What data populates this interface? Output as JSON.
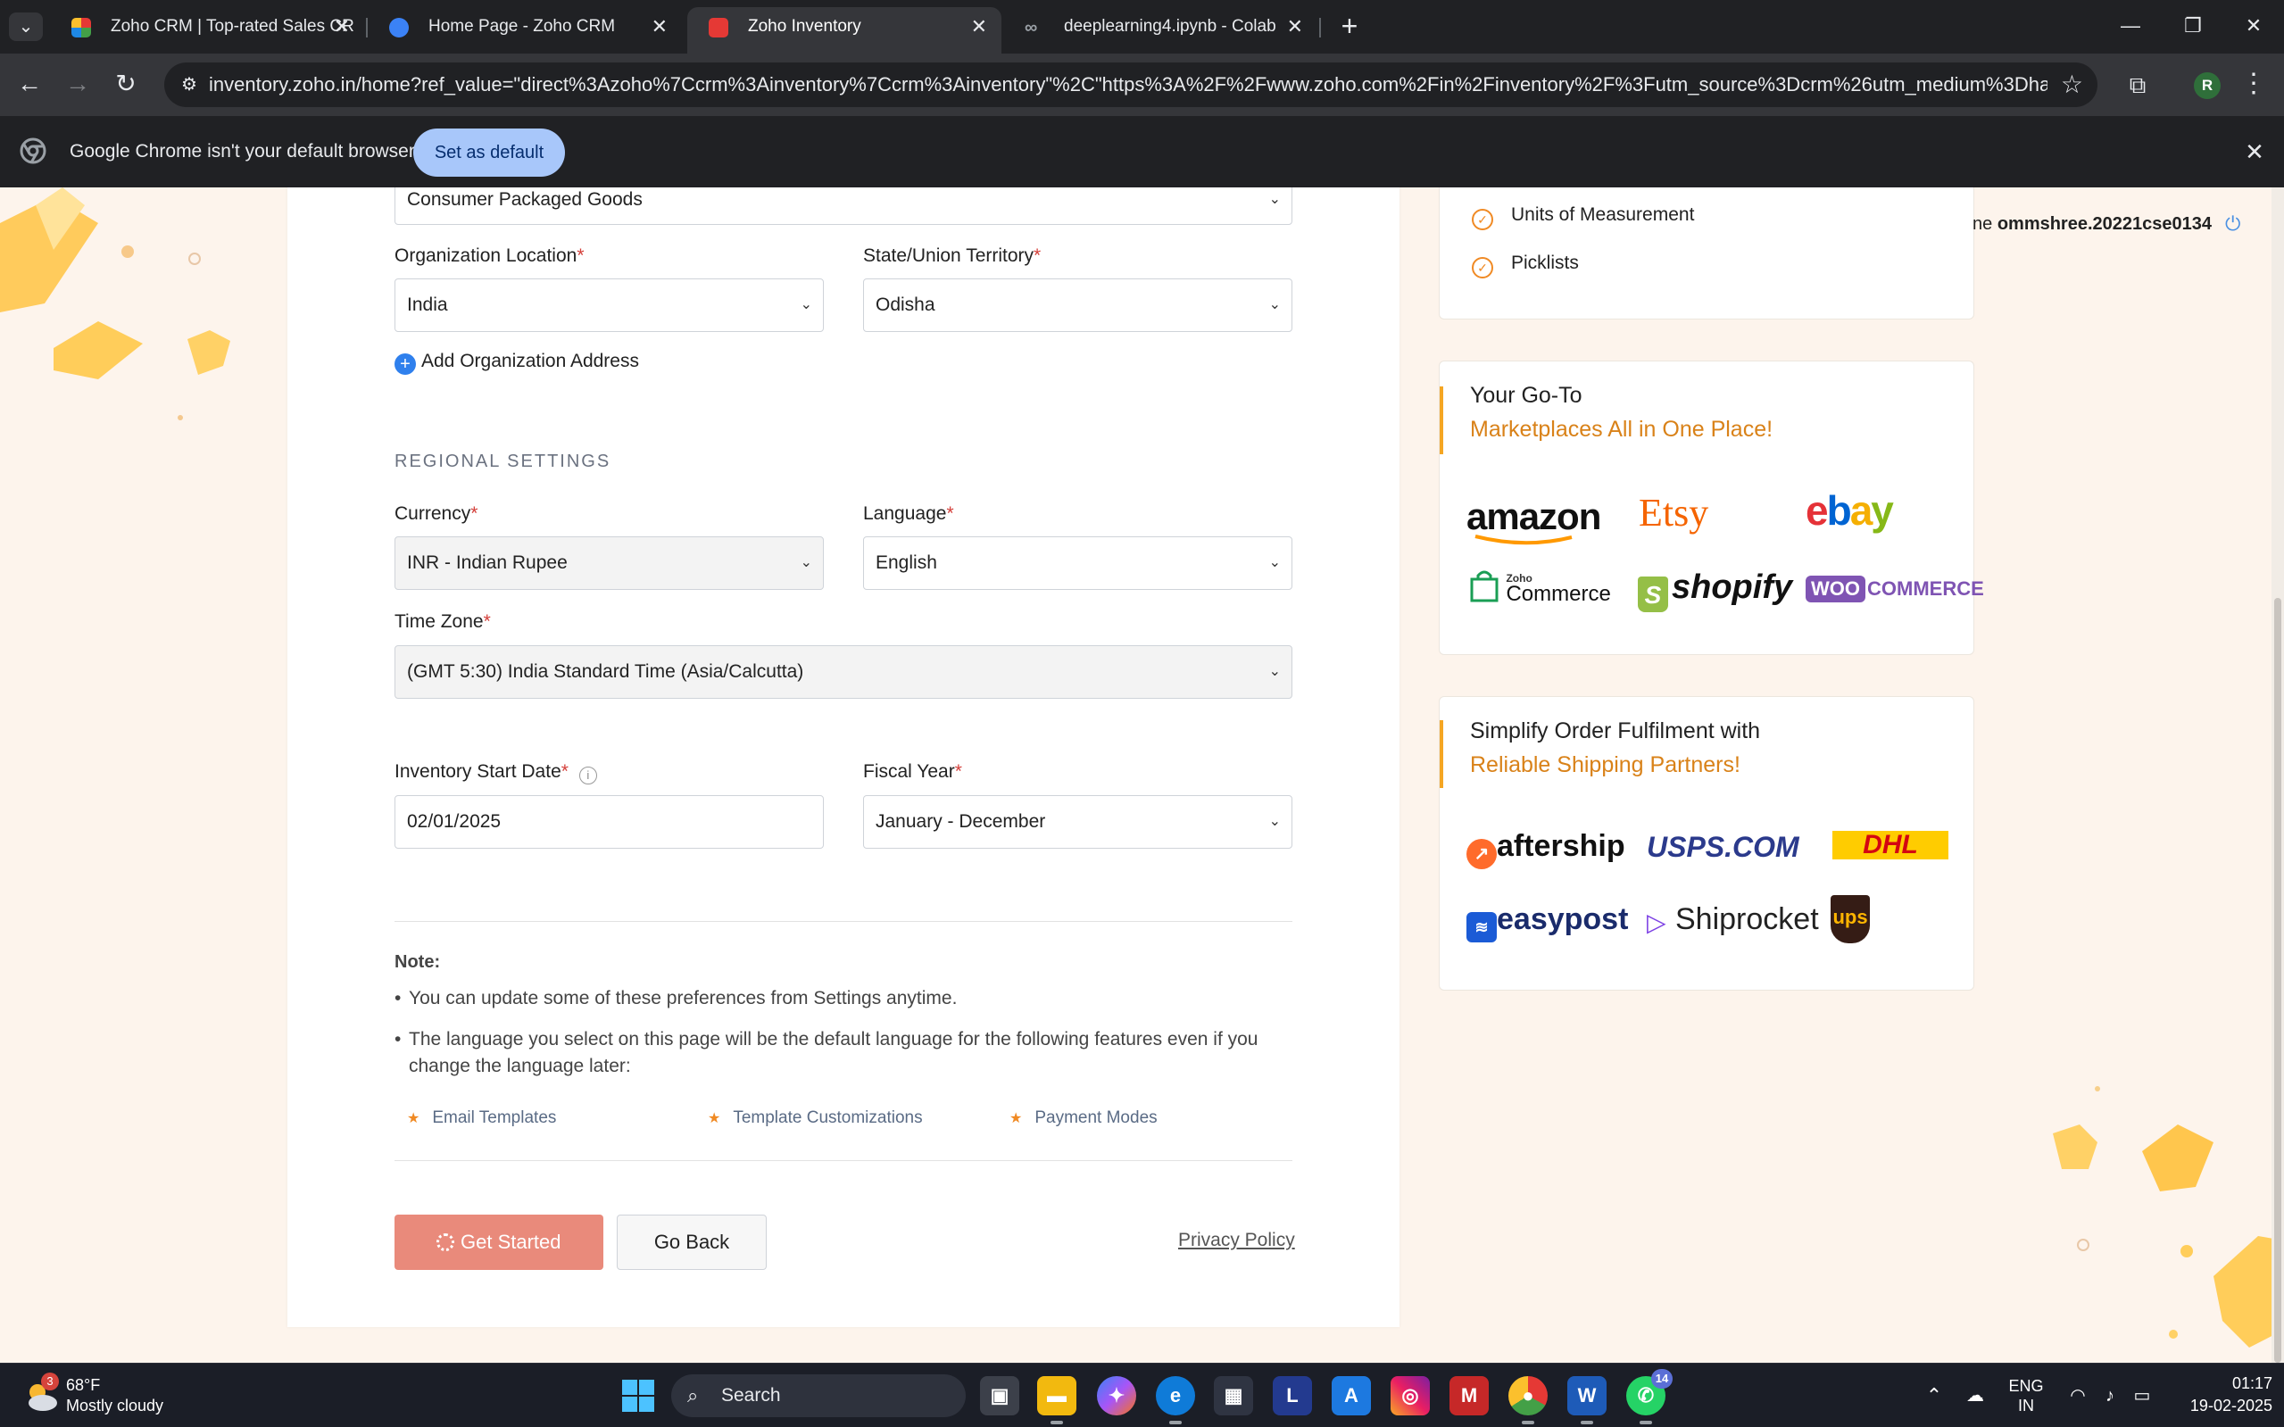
{
  "browser": {
    "tabs": [
      {
        "title": "Zoho CRM | Top-rated Sales CR",
        "active": false
      },
      {
        "title": "Home Page - Zoho CRM",
        "active": false
      },
      {
        "title": "Zoho Inventory",
        "active": true
      },
      {
        "title": "deeplearning4.ipynb - Colab",
        "active": false
      }
    ],
    "url": "inventory.zoho.in/home?ref_value=\"direct%3Azoho%7Ccrm%3Ainventory%7Ccrm%3Ainventory\"%2C\"https%3A%2F%2Fwww.zoho.com%2Fin%2Finventory%2F%3Futm_source%3Dcrm%26utm_medium%3Dhamburger%2...",
    "profile_initial": "R",
    "infobar": {
      "message": "Google Chrome isn't your default browser",
      "button": "Set as default"
    }
  },
  "form": {
    "industry_value": "Consumer Packaged Goods",
    "org_location_label": "Organization Location",
    "org_location_value": "India",
    "state_label": "State/Union Territory",
    "state_value": "Odisha",
    "add_address": "Add Organization Address",
    "regional_title": "REGIONAL SETTINGS",
    "currency_label": "Currency",
    "currency_value": "INR - Indian Rupee",
    "language_label": "Language",
    "language_value": "English",
    "timezone_label": "Time Zone",
    "timezone_value": "(GMT 5:30) India Standard Time (Asia/Calcutta)",
    "inv_start_label": "Inventory Start Date",
    "inv_start_value": "02/01/2025",
    "fiscal_label": "Fiscal Year",
    "fiscal_value": "January - December",
    "required_mark": "*"
  },
  "note": {
    "title": "Note:",
    "item1": "You can update some of these preferences from Settings anytime.",
    "item2": "The language you select on this page will be the default language for the following features even if you change the language later:",
    "features": [
      "Email Templates",
      "Template Customizations",
      "Payment Modes"
    ]
  },
  "actions": {
    "get_started": "Get Started",
    "go_back": "Go Back",
    "privacy": "Privacy Policy"
  },
  "sidebar": {
    "user_prefix": "ne",
    "user_name": "ommshree.20221cse0134",
    "checklist": [
      "Units of Measurement",
      "Picklists"
    ],
    "marketplaces": {
      "heading": "Your Go-To",
      "subheading": "Marketplaces All in One Place!",
      "logos": {
        "amazon": "amazon",
        "etsy": "Etsy",
        "ebay": "ebay",
        "zoho_small": "Zoho",
        "zoho_commerce": "Commerce",
        "shopify": "shopify",
        "woo": "WOO",
        "woo_commerce": "COMMERCE"
      }
    },
    "shipping": {
      "heading": "Simplify Order Fulfilment with",
      "subheading": "Reliable Shipping Partners!",
      "logos": {
        "aftership": "aftership",
        "usps": "USPS.COM",
        "dhl": "DHL",
        "easypost": "easypost",
        "shiprocket": "Shiprocket",
        "ups": "ups"
      }
    }
  },
  "taskbar": {
    "weather_temp": "68°F",
    "weather_cond": "Mostly cloudy",
    "weather_badge": "3",
    "search": "Search",
    "whatsapp_count": "14",
    "lang_top": "ENG",
    "lang_bottom": "IN",
    "time": "01:17",
    "date": "19-02-2025"
  }
}
